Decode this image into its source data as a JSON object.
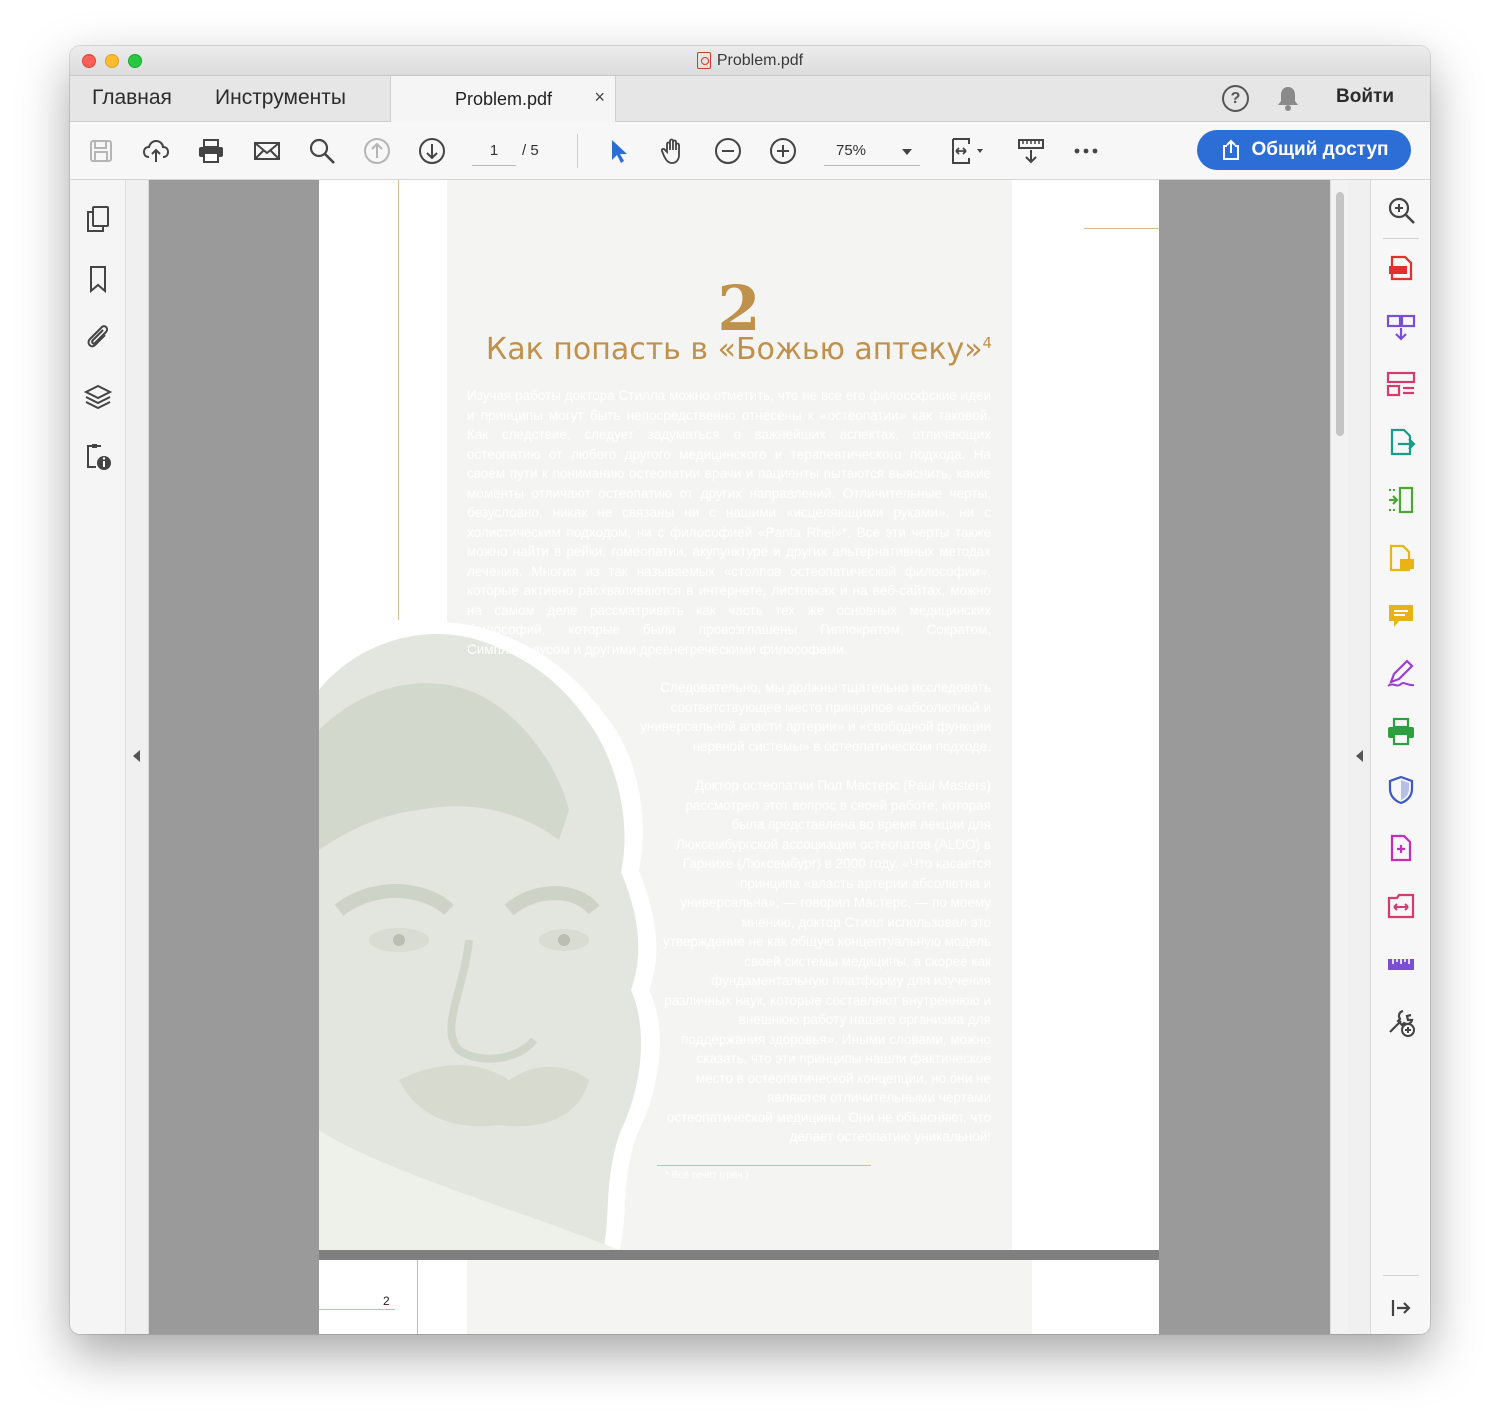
{
  "window": {
    "title": "Problem.pdf"
  },
  "tabs": {
    "home": "Главная",
    "tools": "Инструменты",
    "document": "Problem.pdf",
    "close": "×"
  },
  "header": {
    "help": "?",
    "sign_in": "Войти"
  },
  "toolbar": {
    "page_current": "1",
    "page_total": "/ 5",
    "zoom": "75%",
    "share": "Общий доступ"
  },
  "left_rail": [
    "pages-icon",
    "bookmark-icon",
    "attachment-icon",
    "layers-icon",
    "properties-icon"
  ],
  "right_rail": [
    "search-zoom-icon",
    "create-pdf-icon",
    "combine-icon",
    "organize-icon",
    "export-icon",
    "edit-icon",
    "comment-doc-icon",
    "comment-icon",
    "sign-icon",
    "print-production-icon",
    "protect-icon",
    "rich-media-icon",
    "compare-icon",
    "measure-icon",
    "more-tools-icon",
    "collapse-rail-icon"
  ],
  "colors": {
    "accent": "#2c6ed6",
    "chapter": "#c0914a",
    "rule": "#d7b98a"
  },
  "document": {
    "chapter_number": "2",
    "chapter_title": "Как попасть в «Божью аптеку»",
    "chapter_sup": "4",
    "paragraph1": "Изучая работы доктора Стилла можно отметить, что не все его философские идеи и принципы могут быть непосредственно отнесены к «остеопатии» как таковой. Как следствие, следует задуматься о важнейших аспектах, отличающих остеопатию от любого другого медицинского и терапевтического подхода. На своем пути к пониманию остеопатии врачи и пациенты пытаются выяснить, какие моменты отличают остеопатию от других направлений. Отличительные черты, безусловно, никак не связаны ни с нашими «исцеляющими руками», ни с холистическим подходом, ни с философией «Panta Rhei»*. Все эти черты также можно найти в рейки, гомеопатии, акупунктуре и других альтернативных методах лечения. Многих из так называемых «столпов остеопатической философии», которые активно расхваливаются в интернете, листовках и на веб-сайтах, можно на самом деле рассматривать как часть тех же основных медицинских философий, которые были провозглашены Гиппократом, Сократом, Симплицидусом и другими древнегреческими философами.",
    "paragraph2": "Следовательно, мы должны тщательно исследовать соответствующее место принципов «абсолютной и универсальной власти артерии» и «свободной функции нервной системы» в остеопатическом подходе.",
    "paragraph3": "Доктор остеопатии Пол Мастерс (Paul Masters) рассмотрел этот вопрос в своей работе, которая была представлена во время лекции для Люксембургской ассоциации остеопатов (ALDO) в Гарнихе (Люксембург) в 2000 году. «Что касается принципа «власть артерии абсолютна и универсальна», — говорил Мастерс, — по моему мнению, доктор Стилл использовал это утверждение не как общую концептуальную модель своей системы медицины, а скорее как фундаментальную платформу для изучения различных наук, которые составляют внутреннюю и внешнюю работу нашего организма для поддержания здоровья». Иными словами, можно сказать, что эти принципы нашли фактическое место в остеопатической концепции, но они не являются отличительными чертами остеопатической медицины. Они не объясняют, что делает остеопатию уникальной!",
    "footnote": "* Всё течёт (греч.)",
    "page2_number": "2"
  }
}
